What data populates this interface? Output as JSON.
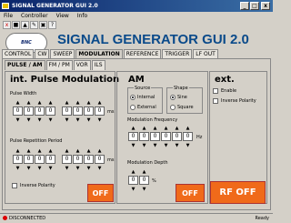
{
  "window": {
    "title": "SIGNAL GENERATOR GUI 2.0",
    "min": "_",
    "max": "□",
    "close": "x"
  },
  "menu": [
    "File",
    "Controller",
    "View",
    "Info"
  ],
  "toolbar": [
    "x",
    "■",
    "▲",
    "✎",
    "▣",
    "?"
  ],
  "logo": {
    "text": "BNC"
  },
  "app_title": "SIGNAL GENERATOR GUI 2.0",
  "tabs": [
    "CONTROL",
    "CW",
    "SWEEP",
    "MODULATION",
    "REFERENCE",
    "TRIGGER",
    "LF OUT"
  ],
  "active_tab": "MODULATION",
  "subtabs": [
    "PULSE / AM",
    "FM / PM",
    "VOR",
    "ILS"
  ],
  "active_subtab": "PULSE / AM",
  "pulse": {
    "title": "int. Pulse Modulation",
    "width_label": "Pulse Width",
    "width_digits_a": [
      "0",
      "0",
      "0",
      "0"
    ],
    "width_digits_b": [
      "0",
      "0",
      "0",
      "0"
    ],
    "unit": "ms",
    "period_label": "Pulse Repetition Period",
    "period_digits_a": [
      "0",
      "0",
      "0",
      "0"
    ],
    "period_digits_b": [
      "0",
      "0",
      "0",
      "0"
    ],
    "inverse_label": "Inverse Polarity",
    "off_label": "OFF"
  },
  "am": {
    "title": "AM",
    "source_label": "Source",
    "source_options": [
      "Internal",
      "External"
    ],
    "shape_label": "Shape",
    "shape_options": [
      "Sine",
      "Square"
    ],
    "freq_label": "Modulation Frequency",
    "freq_digits": [
      "0",
      "0",
      "0",
      "0",
      "0",
      "0"
    ],
    "freq_unit": "Hz",
    "depth_label": "Modulation Depth",
    "depth_digits": [
      "0",
      "0"
    ],
    "depth_unit": "%",
    "off_label": "OFF"
  },
  "ext": {
    "title": "ext.",
    "enable_label": "Enable",
    "inverse_label": "Inverse Polarity"
  },
  "rf_off": "RF OFF",
  "status": {
    "left": "DISCONNECTED",
    "right": "Ready"
  },
  "colors": {
    "accent": "#f06a1a",
    "title": "#0a4a8a",
    "titlebar": "#0a246a"
  }
}
